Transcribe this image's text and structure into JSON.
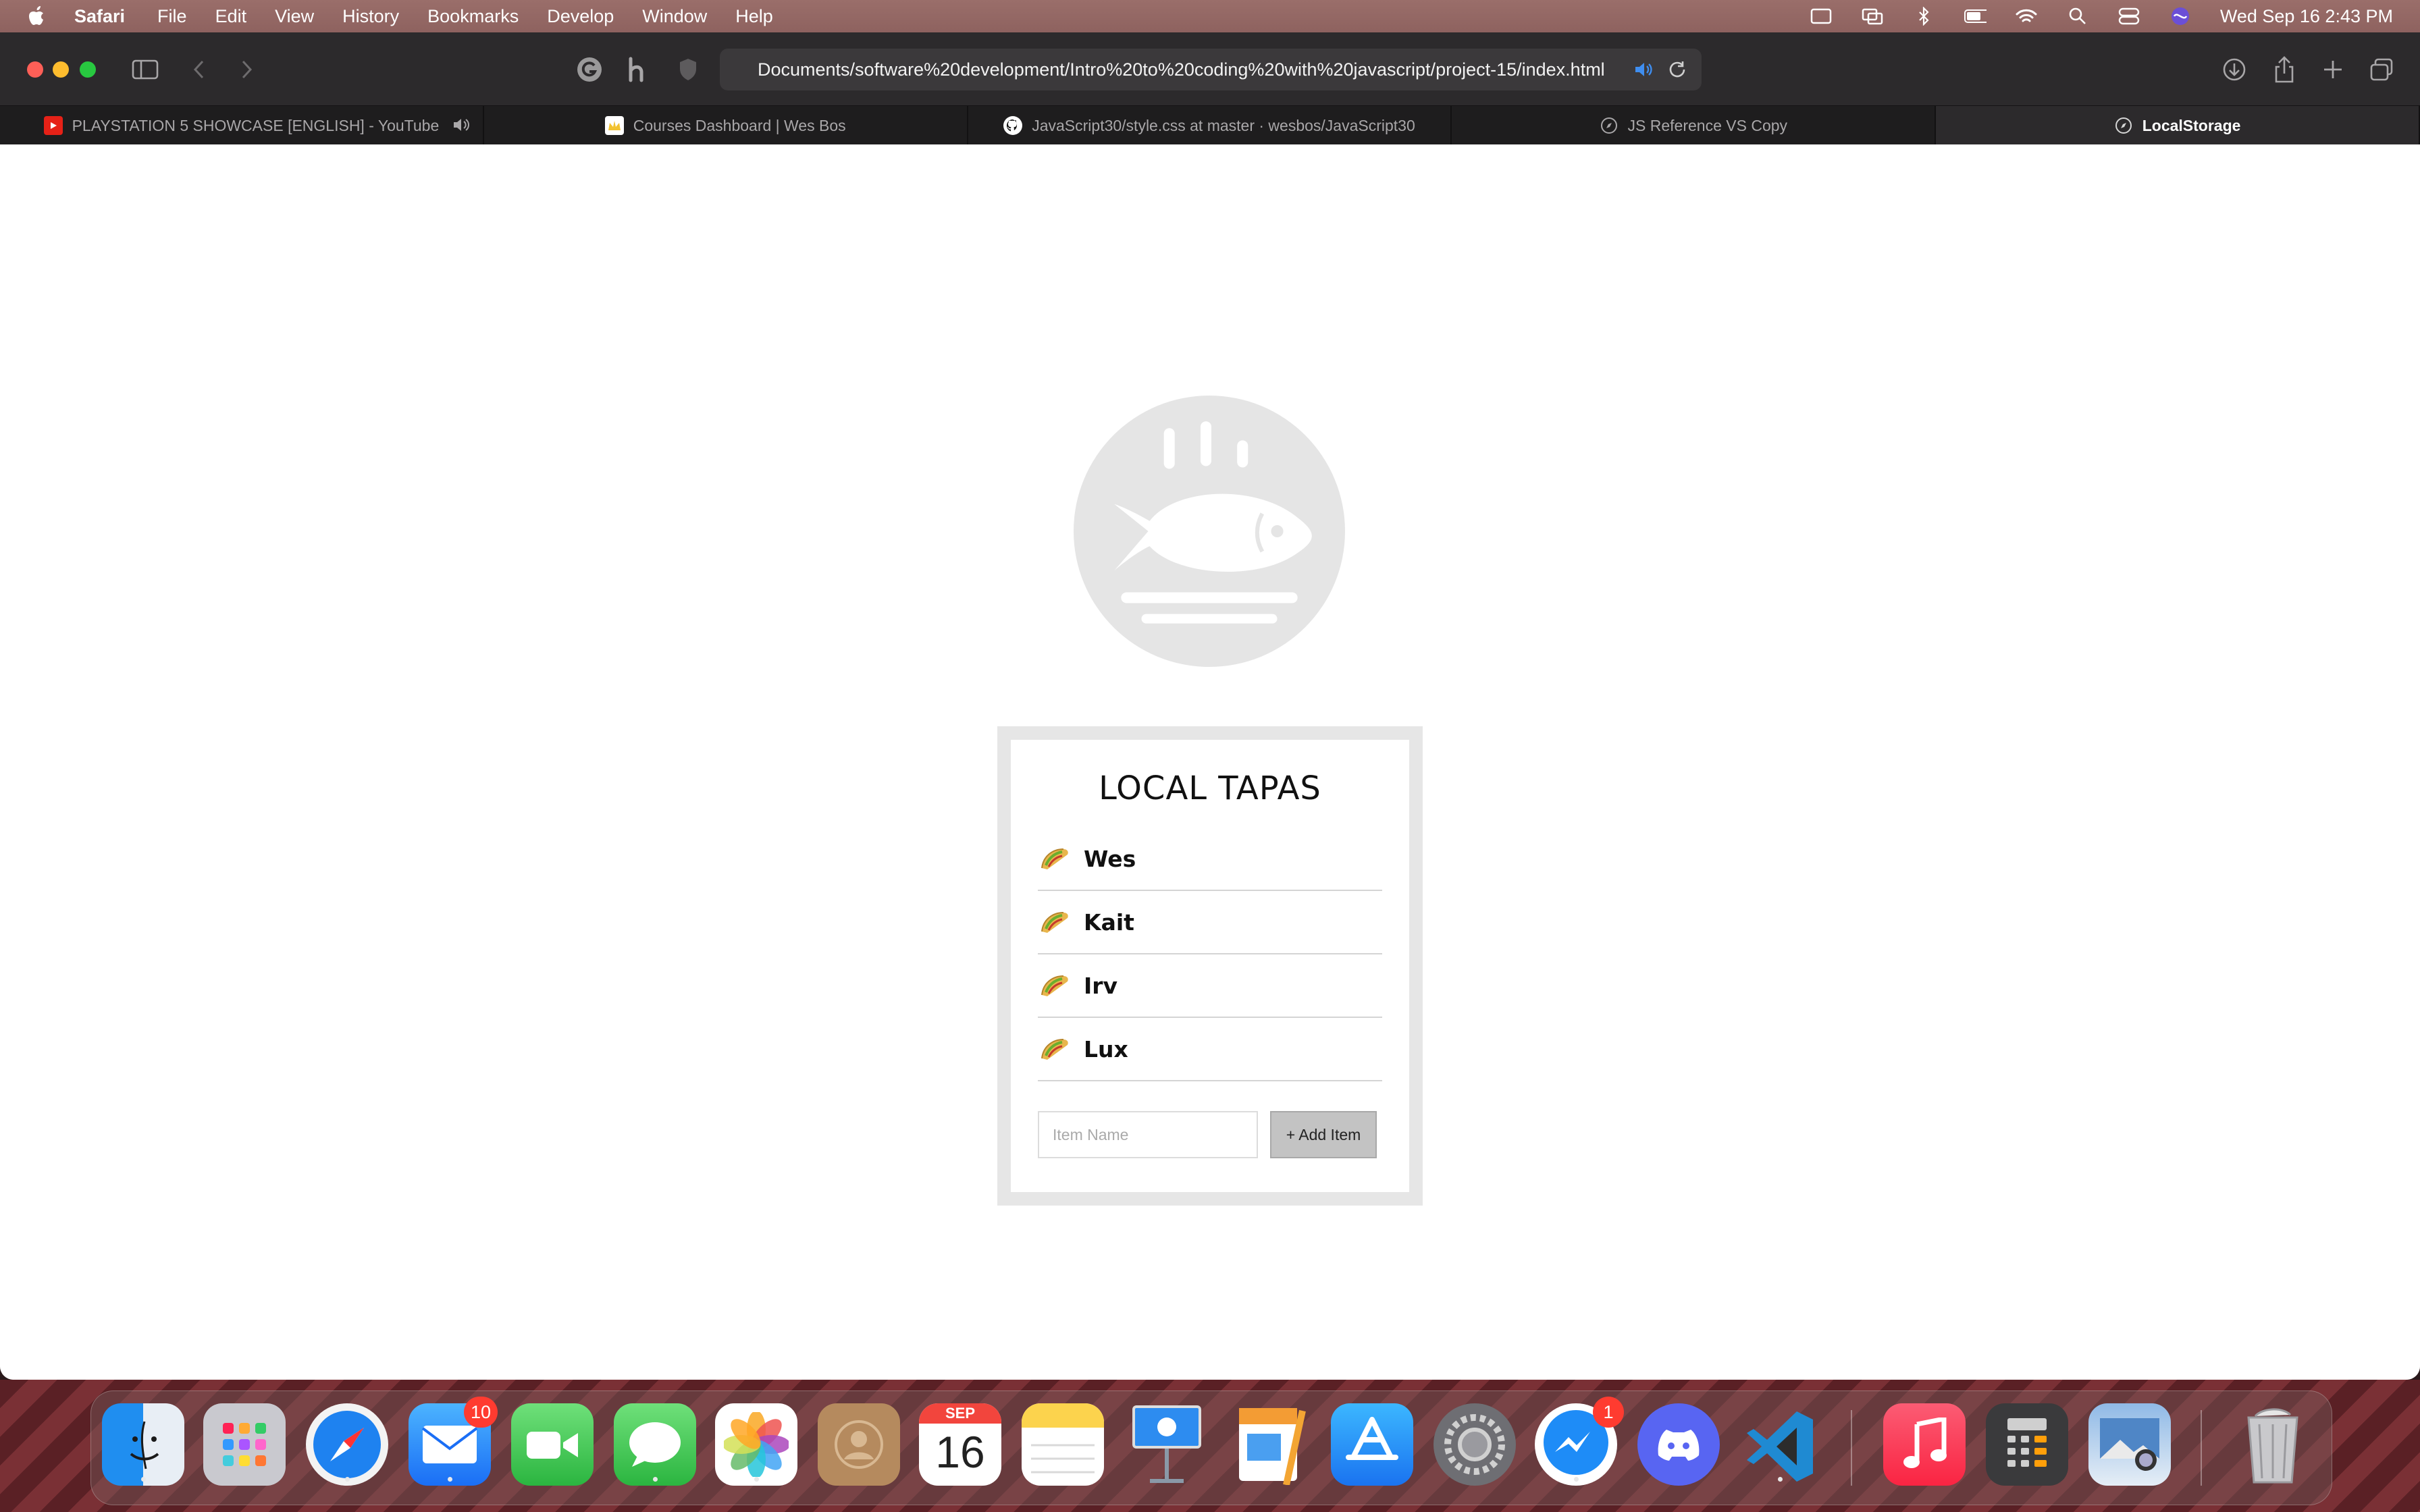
{
  "menubar": {
    "app_name": "Safari",
    "items": [
      "File",
      "Edit",
      "View",
      "History",
      "Bookmarks",
      "Develop",
      "Window",
      "Help"
    ],
    "clock": "Wed Sep 16  2:43 PM"
  },
  "browser": {
    "url": "Documents/software%20development/Intro%20to%20coding%20with%20javascript/project-15/index.html",
    "tabs": [
      {
        "title": "PLAYSTATION 5 SHOWCASE [ENGLISH] - YouTube",
        "favicon": "youtube-icon",
        "audio": true
      },
      {
        "title": "Courses Dashboard | Wes Bos",
        "favicon": "crown-icon"
      },
      {
        "title": "JavaScript30/style.css at master · wesbos/JavaScript30",
        "favicon": "github-icon"
      },
      {
        "title": "JS Reference VS Copy",
        "favicon": "compass-icon"
      },
      {
        "title": "LocalStorage",
        "favicon": "compass-icon",
        "active": true
      }
    ]
  },
  "app": {
    "title": "LOCAL TAPAS",
    "items": [
      {
        "name": "Wes",
        "icon": "taco-icon"
      },
      {
        "name": "Kait",
        "icon": "taco-icon"
      },
      {
        "name": "Irv",
        "icon": "taco-icon"
      },
      {
        "name": "Lux",
        "icon": "taco-icon"
      }
    ],
    "input_placeholder": "Item Name",
    "add_button_label": "+ Add Item"
  },
  "dock": {
    "calendar_month": "SEP",
    "calendar_day": "16",
    "mail_badge": "10",
    "messenger_badge": "1"
  }
}
